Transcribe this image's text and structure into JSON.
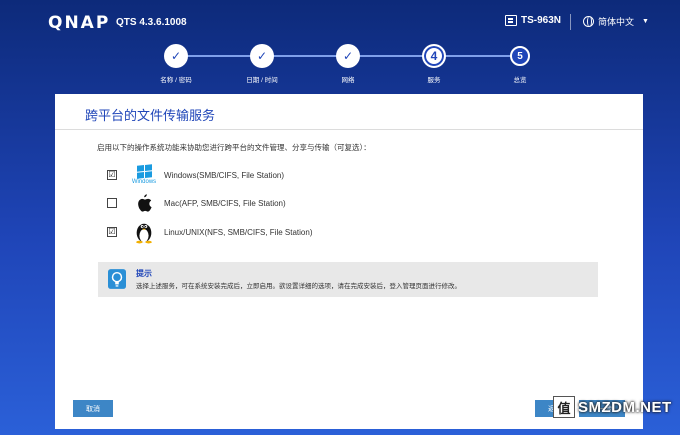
{
  "header": {
    "logo": "QNAP",
    "version": "QTS 4.3.6.1008",
    "model": "TS-963N",
    "language": "简体中文",
    "caret": "▼"
  },
  "steps": [
    {
      "label": "名称 / 密码",
      "mark": "✓",
      "state": "done"
    },
    {
      "label": "日期 / 时间",
      "mark": "✓",
      "state": "done"
    },
    {
      "label": "网络",
      "mark": "✓",
      "state": "done"
    },
    {
      "label": "服务",
      "mark": "4",
      "state": "current"
    },
    {
      "label": "总览",
      "mark": "5",
      "state": "pending"
    }
  ],
  "panel": {
    "title": "跨平台的文件传输服务",
    "intro": "启用以下的操作系统功能来协助您进行跨平台的文件管理、分享与传输（可复选）：",
    "options": [
      {
        "icon": "windows-logo-icon",
        "icon_caption": "Windows",
        "label": "Windows(SMB/CIFS, File Station)",
        "checked": true
      },
      {
        "icon": "apple-logo-icon",
        "label": "Mac(AFP, SMB/CIFS, File Station)",
        "checked": false
      },
      {
        "icon": "linux-tux-icon",
        "label": "Linux/UNIX(NFS, SMB/CIFS, File Station)",
        "checked": true
      }
    ],
    "checked_mark": "☑"
  },
  "hint": {
    "title": "提示",
    "text": "选择上述服务，可在系统安装完成后，立即启用。欲设置详细的选项，请在完成安装后，登入管理页面进行修改。"
  },
  "buttons": {
    "cancel": "取消",
    "back": "返回",
    "next": "下一步"
  },
  "watermark": {
    "badge": "值",
    "text": "SMZDM.NET"
  },
  "colors": {
    "brand_blue": "#1f45b8",
    "button": "#3d86c6",
    "hint_bg": "#e8e8e8"
  }
}
